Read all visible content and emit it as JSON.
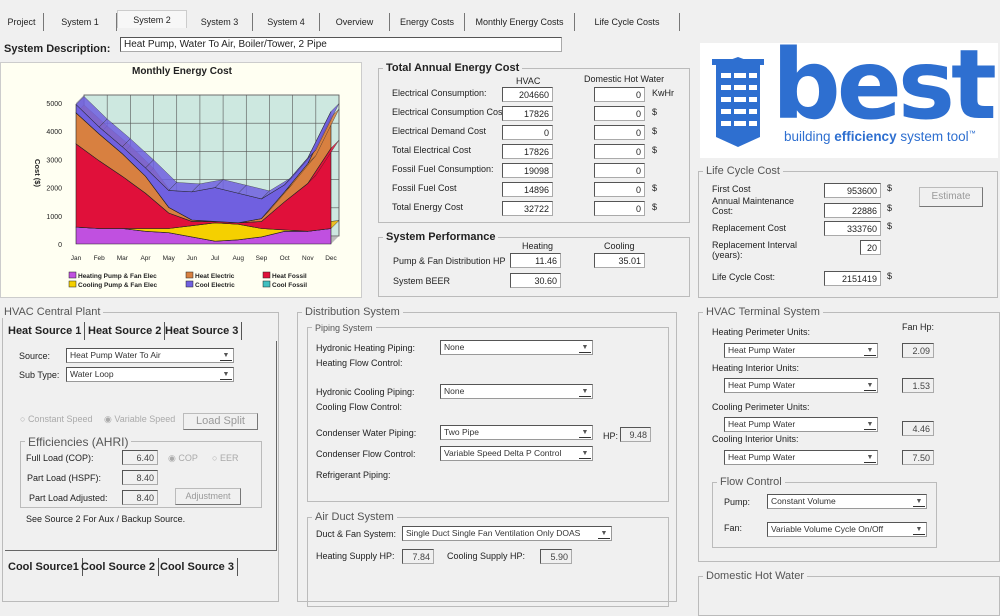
{
  "tabs": [
    "Project",
    "System 1",
    "System 2",
    "System 3",
    "System 4",
    "Overview",
    "Energy Costs",
    "Monthly Energy Costs",
    "Life Cycle Costs"
  ],
  "selected_tab": "System 2",
  "system_description": {
    "label": "System Description:",
    "value": "Heat Pump, Water To Air, Boiler/Tower, 2 Pipe"
  },
  "chart_data": {
    "type": "area",
    "stacked": true,
    "title": "Monthly Energy Cost",
    "xlabel": "",
    "ylabel": "Cost ($)",
    "categories": [
      "Jan",
      "Feb",
      "Mar",
      "Apr",
      "May",
      "Jun",
      "Jul",
      "Aug",
      "Sep",
      "Oct",
      "Nov",
      "Dec"
    ],
    "ylim": [
      0,
      5000
    ],
    "yticks": [
      0,
      1000,
      2000,
      3000,
      4000,
      5000
    ],
    "grid": true,
    "legend_position": "bottom",
    "series": [
      {
        "name": "Heating Pump & Fan Elec",
        "color": "#c050e0",
        "values": [
          600,
          550,
          550,
          450,
          400,
          250,
          100,
          150,
          250,
          450,
          450,
          550
        ]
      },
      {
        "name": "Cooling Pump & Fan Elec",
        "color": "#f5d000",
        "values": [
          0,
          0,
          0,
          100,
          150,
          400,
          650,
          550,
          300,
          50,
          0,
          0
        ]
      },
      {
        "name": "Heat Fossil",
        "color": "#e0103a",
        "values": [
          2950,
          2400,
          1850,
          1250,
          550,
          150,
          50,
          50,
          250,
          1000,
          1700,
          2850
        ]
      },
      {
        "name": "Heat Electric",
        "color": "#d88040",
        "values": [
          1100,
          950,
          800,
          600,
          200,
          50,
          0,
          0,
          100,
          350,
          700,
          1100
        ]
      },
      {
        "name": "Cool Electric",
        "color": "#7060e0",
        "values": [
          300,
          250,
          250,
          300,
          600,
          1000,
          1200,
          1050,
          700,
          250,
          200,
          200
        ]
      },
      {
        "name": "Cool Fossil",
        "color": "#40c0c0",
        "values": [
          0,
          0,
          0,
          0,
          0,
          0,
          0,
          0,
          0,
          0,
          0,
          0
        ]
      }
    ]
  },
  "energy": {
    "title": "Total Annual Energy Cost",
    "col_hvac": "HVAC",
    "col_dhw": "Domestic Hot Water",
    "rows": [
      {
        "label": "Electrical Consumption:",
        "hvac": "204660",
        "dhw": "0",
        "unit": "KwHr"
      },
      {
        "label": "Electrical Consumption Cost",
        "hvac": "17826",
        "dhw": "0",
        "unit": "$"
      },
      {
        "label": "Electrical Demand Cost",
        "hvac": "0",
        "dhw": "0",
        "unit": "$"
      },
      {
        "label": "Total Electrical Cost",
        "hvac": "17826",
        "dhw": "0",
        "unit": "$"
      },
      {
        "label": "Fossil Fuel Consumption:",
        "hvac": "19098",
        "dhw": "0",
        "unit": ""
      },
      {
        "label": "Fossil Fuel Cost",
        "hvac": "14896",
        "dhw": "0",
        "unit": "$"
      },
      {
        "label": "Total Energy Cost",
        "hvac": "32722",
        "dhw": "0",
        "unit": "$"
      }
    ]
  },
  "performance": {
    "title": "System Performance",
    "col_heating": "Heating",
    "col_cooling": "Cooling",
    "pump_label": "Pump & Fan Distribution HP",
    "pump_heating": "11.46",
    "pump_cooling": "35.01",
    "beer_label": "System BEER",
    "beer_heating": "30.60"
  },
  "logo": {
    "word": "best",
    "tagline_1": "building ",
    "tagline_2": "efficiency",
    "tagline_3": " system tool",
    "tm": "™",
    "color": "#2e6fd0",
    "light": "#2aa0e8"
  },
  "lcc": {
    "title": "Life Cycle Cost",
    "estimate": "Estimate",
    "first_label": "First Cost",
    "first": "953600",
    "maint_label": "Annual Maintenance Cost:",
    "maint": "22886",
    "repl_label": "Replacement Cost",
    "repl": "333760",
    "interval_label": "Replacement Interval (years):",
    "interval": "20",
    "lcc_label": "Life Cycle Cost:",
    "lcc": "2151419",
    "unit": "$"
  },
  "plant": {
    "title": "HVAC Central Plant",
    "heat_tabs": [
      "Heat Source 1",
      "Heat Source 2",
      "Heat Source 3"
    ],
    "source_label": "Source:",
    "source": "Heat Pump Water To Air",
    "subtype_label": "Sub Type:",
    "subtype": "Water Loop",
    "constant": "Constant Speed",
    "variable": "Variable Speed",
    "load_split": "Load Split",
    "eff_title": "Efficiencies (AHRI)",
    "full_label": "Full Load (COP):",
    "full": "6.40",
    "cop": "COP",
    "eer": "EER",
    "part_label": "Part Load (HSPF):",
    "part": "8.40",
    "adj_label": "Part Load Adjusted:",
    "adj": "8.40",
    "adjustment": "Adjustment",
    "note": "See Source 2 For Aux / Backup Source.",
    "cool_tabs": [
      "Cool Source1",
      "Cool Source 2",
      "Cool Source 3"
    ]
  },
  "dist": {
    "title": "Distribution System",
    "piping_title": "Piping System",
    "hh_label": "Hydronic Heating Piping:",
    "hh": "None",
    "hfc_label": "Heating Flow Control:",
    "hc_label": "Hydronic Cooling Piping:",
    "hc": "None",
    "cfc_label": "Cooling Flow Control:",
    "cw_label": "Condenser Water Piping:",
    "cw": "Two Pipe",
    "hp_label": "HP:",
    "hp": "9.48",
    "cf_label": "Condenser Flow Control:",
    "cf": "Variable Speed Delta P Control",
    "ref_label": "Refrigerant Piping:",
    "air_title": "Air Duct System",
    "duct_label": "Duct & Fan System:",
    "duct": "Single Duct Single Fan Ventilation Only DOAS",
    "hs_label": "Heating Supply HP:",
    "hs": "7.84",
    "cs_label": "Cooling Supply HP:",
    "cs": "5.90"
  },
  "terminal": {
    "title": "HVAC Terminal System",
    "fan_hp": "Fan Hp:",
    "units": [
      {
        "label": "Heating Perimeter Units:",
        "value": "Heat Pump Water",
        "hp": "2.09"
      },
      {
        "label": "Heating Interior Units:",
        "value": "Heat Pump Water",
        "hp": "1.53"
      },
      {
        "label": "Cooling Perimeter Units:",
        "value": "Heat Pump Water",
        "hp": "4.46"
      },
      {
        "label": "Cooling Interior Units:",
        "value": "Heat Pump Water",
        "hp": "7.50"
      }
    ],
    "flow_title": "Flow Control",
    "pump_label": "Pump:",
    "pump": "Constant Volume",
    "fan_label": "Fan:",
    "fan": "Variable Volume Cycle On/Off"
  },
  "dhw": {
    "title": "Domestic Hot Water"
  }
}
